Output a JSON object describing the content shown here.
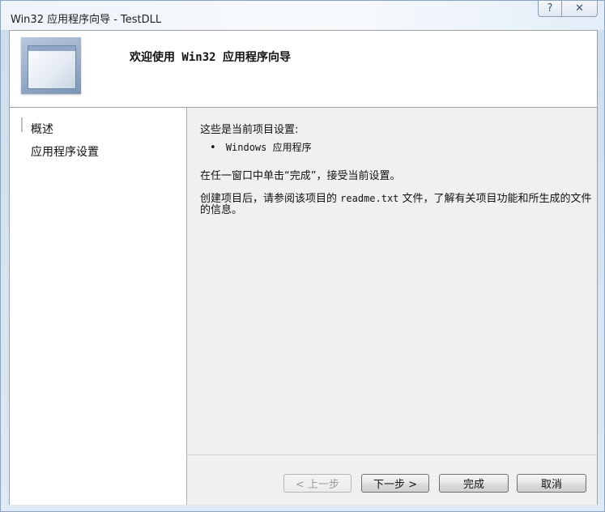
{
  "window": {
    "title": "Win32 应用程序向导 - TestDLL",
    "help_glyph": "?",
    "close_glyph": "✕"
  },
  "header": {
    "title": "欢迎使用 Win32 应用程序向导"
  },
  "nav": {
    "items": [
      {
        "label": "概述"
      },
      {
        "label": "应用程序设置"
      }
    ]
  },
  "content": {
    "intro": "这些是当前项目设置:",
    "bullet_char": "•",
    "bullet_text": "Windows 应用程序",
    "finish_hint": "在任一窗口中单击“完成”，接受当前设置。",
    "readme_hint_part1": "创建项目后，请参阅该项目的 ",
    "readme_file": "readme.txt",
    "readme_hint_part2": " 文件，了解有关项目功能和所生成的文件的信息。"
  },
  "buttons": {
    "back": "< 上一步",
    "next": "下一步 >",
    "finish": "完成",
    "cancel": "取消"
  }
}
